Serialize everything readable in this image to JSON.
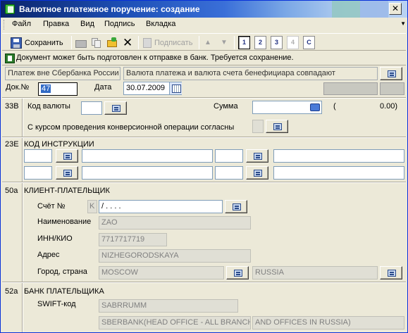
{
  "window": {
    "title": "Валютное платежное поручение: создание",
    "close_glyph": "✕"
  },
  "menu": {
    "items": [
      "Файл",
      "Правка",
      "Вид",
      "Подпись",
      "Вкладка"
    ]
  },
  "toolbar": {
    "save_label": "Сохранить",
    "sign_label": "Подписать",
    "tabs": [
      "1",
      "2",
      "3",
      "4",
      "C"
    ]
  },
  "status": {
    "text": "Документ может быть подготовлен к отправке в банк. Требуется сохранение."
  },
  "header": {
    "payment_outside": "Платеж вне Сбербанка России",
    "currency_match": "Валюта платежа и валюта счета бенефициара совпадают",
    "doc_no_label": "Док.№",
    "doc_no_value": "47",
    "date_label": "Дата",
    "date_value": "30.07.2009"
  },
  "s33b": {
    "num": "33B",
    "currency_code_label": "Код валюты",
    "amount_label": "Сумма",
    "amount_paren": "(",
    "amount_value": "0.00)",
    "conversion_label": "С курсом проведения конверсионной операции согласны"
  },
  "s23e": {
    "num": "23E",
    "title": "КОД ИНСТРУКЦИИ"
  },
  "s50a": {
    "num": "50a",
    "title": "КЛИЕНТ-ПЛАТЕЛЬЩИК",
    "account_label": "Счёт №",
    "account_prefix": "K",
    "account_value": "/    .     .     .                   .",
    "name_label": "Наименование",
    "name_value": "ZAO",
    "inn_label": "ИНН/КИО",
    "inn_value": "7717717719",
    "address_label": "Адрес",
    "address_value": "NIZHEGORODSKAYA",
    "city_label": "Город, страна",
    "city_value": "MOSCOW",
    "country_value": "RUSSIA"
  },
  "s52a": {
    "num": "52a",
    "title": "БАНК ПЛАТЕЛЬЩИКА",
    "swift_label": "SWIFT-код",
    "swift_value": "SABRRUMM",
    "bank_name_1": "SBERBANK(HEAD OFFICE - ALL BRANCHES",
    "bank_name_2": "AND OFFICES IN RUSSIA)"
  }
}
